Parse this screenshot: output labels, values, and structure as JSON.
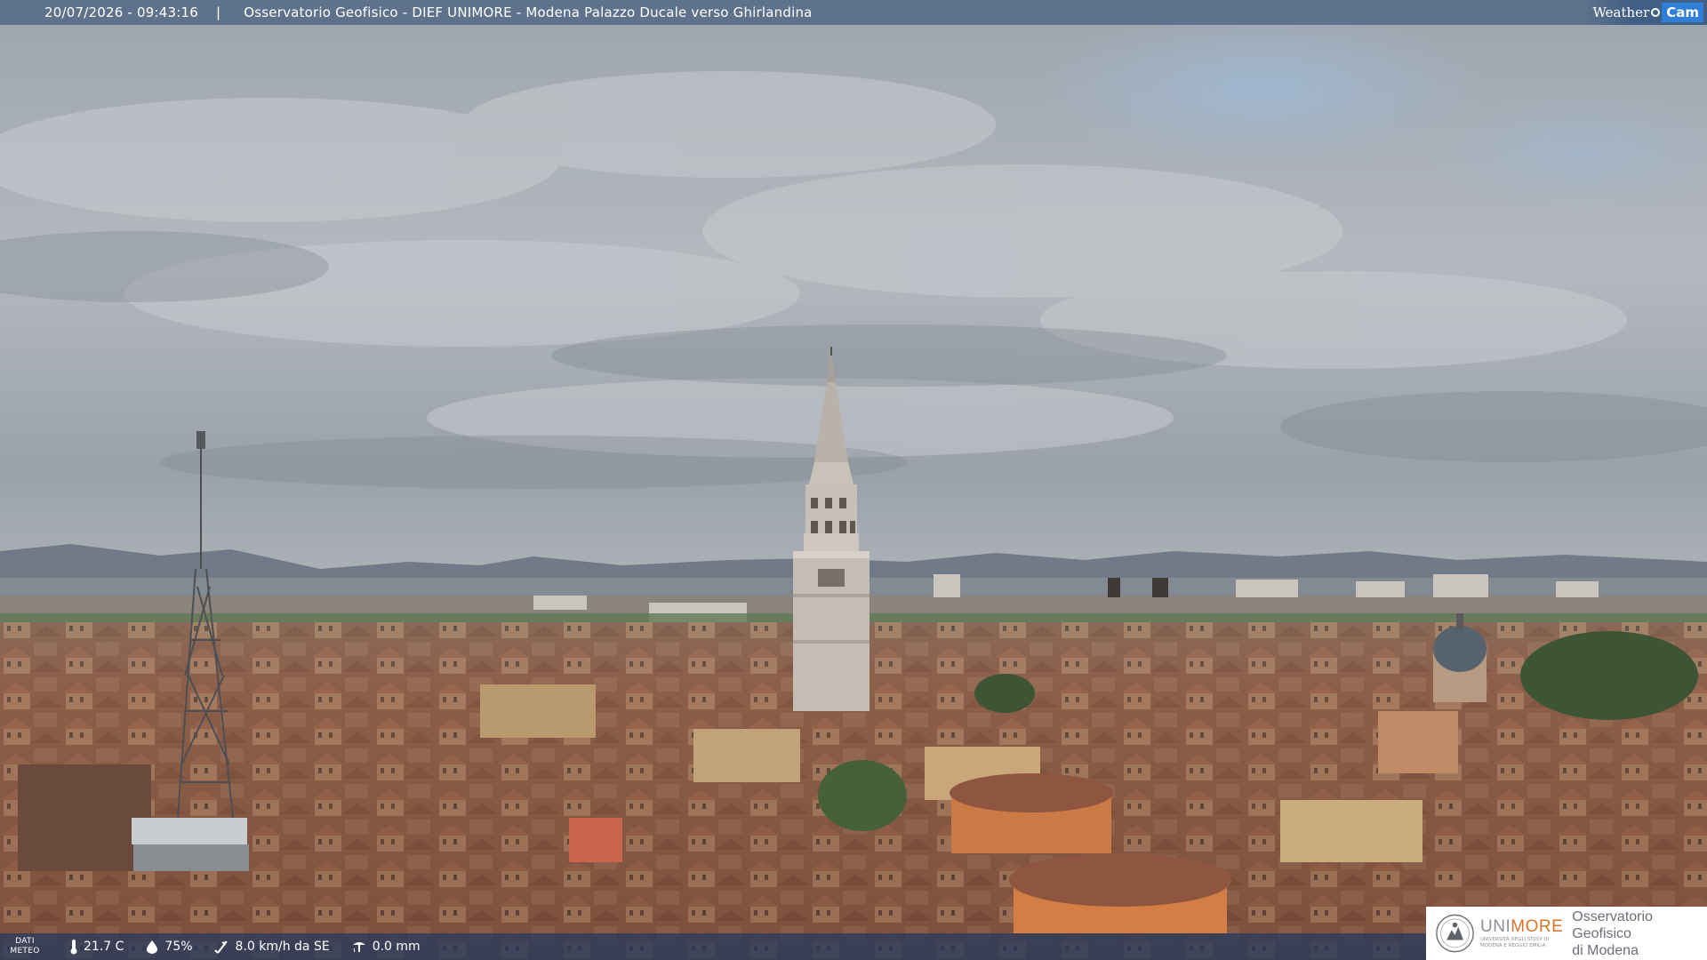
{
  "header": {
    "timestamp": "20/07/2026 - 09:43:16",
    "separator": "|",
    "title": "Osservatorio Geofisico - DIEF UNIMORE - Modena Palazzo Ducale verso Ghirlandina"
  },
  "logo": {
    "weather": "Weather",
    "cam": "Cam"
  },
  "meteo": {
    "label_line1": "DATI",
    "label_line2": "METEO",
    "temperature": "21.7 C",
    "humidity": "75%",
    "wind": "8.0 km/h da SE",
    "rain": "0.0 mm"
  },
  "brand": {
    "uni_part1": "UNI",
    "uni_part2": "MORE",
    "uni_sub_line1": "UNIVERSITÀ DEGLI STUDI DI",
    "uni_sub_line2": "MODENA E REGGIO EMILIA",
    "observatory_line1": "Osservatorio Geofisico",
    "observatory_line2": "di Modena"
  },
  "colors": {
    "accent": "#d9722a",
    "bar": "#465e80"
  }
}
